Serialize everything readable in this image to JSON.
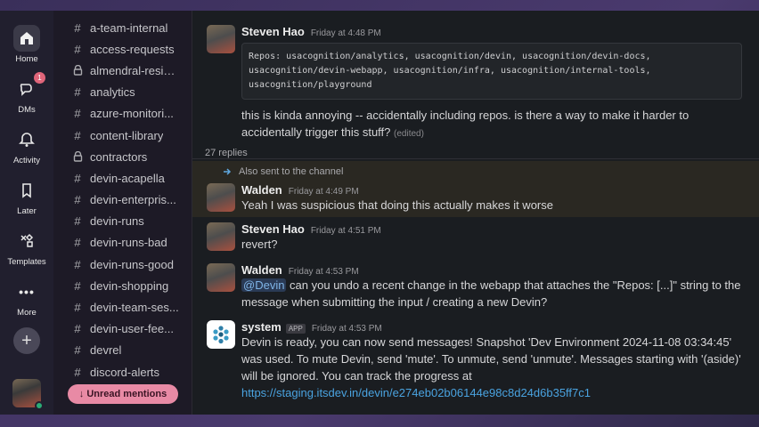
{
  "rail": {
    "items": [
      {
        "label": "Home"
      },
      {
        "label": "DMs",
        "badge": "1"
      },
      {
        "label": "Activity"
      },
      {
        "label": "Later"
      },
      {
        "label": "Templates"
      },
      {
        "label": "More"
      }
    ]
  },
  "channels": {
    "items": [
      {
        "name": "a-team-internal",
        "icon": "hash"
      },
      {
        "name": "access-requests",
        "icon": "hash"
      },
      {
        "name": "almendral-resid...",
        "icon": "lock"
      },
      {
        "name": "analytics",
        "icon": "hash"
      },
      {
        "name": "azure-monitori...",
        "icon": "hash"
      },
      {
        "name": "content-library",
        "icon": "hash"
      },
      {
        "name": "contractors",
        "icon": "lock"
      },
      {
        "name": "devin-acapella",
        "icon": "hash"
      },
      {
        "name": "devin-enterpris...",
        "icon": "hash"
      },
      {
        "name": "devin-runs",
        "icon": "hash"
      },
      {
        "name": "devin-runs-bad",
        "icon": "hash"
      },
      {
        "name": "devin-runs-good",
        "icon": "hash"
      },
      {
        "name": "devin-shopping",
        "icon": "hash"
      },
      {
        "name": "devin-team-ses...",
        "icon": "hash"
      },
      {
        "name": "devin-user-fee...",
        "icon": "hash"
      },
      {
        "name": "devrel",
        "icon": "hash"
      },
      {
        "name": "discord-alerts",
        "icon": "hash"
      }
    ],
    "unread_label": "↓ Unread mentions"
  },
  "thread": {
    "root": {
      "author": "Steven Hao",
      "time": "Friday at 4:48 PM",
      "code_lines": [
        "Repos: usacognition/analytics, usacognition/devin, usacognition/devin-docs,",
        "usacognition/devin-webapp, usacognition/infra, usacognition/internal-tools,",
        "usacognition/playground"
      ],
      "text_line1": "this is kinda annoying -- accidentally including repos. is there a way to make it harder to",
      "text_line2": "accidentally trigger this stuff?",
      "edited": "(edited)"
    },
    "replies_count": "27 replies",
    "also_sent": "Also sent to the channel",
    "replies": [
      {
        "author": "Walden",
        "time": "Friday at 4:49 PM",
        "text": "Yeah I was suspicious that doing this actually makes it worse"
      },
      {
        "author": "Steven Hao",
        "time": "Friday at 4:51 PM",
        "text": "revert?"
      },
      {
        "author": "Walden",
        "time": "Friday at 4:53 PM",
        "mention": "@Devin",
        "text_line1": " can you undo a recent change in the webapp that attaches the \"Repos: [...]\" string to the",
        "text_line2": "message when submitting the input / creating a new Devin?"
      },
      {
        "author": "system",
        "app_tag": "APP",
        "time": "Friday at 4:53 PM",
        "lines": [
          "Devin is ready, you can now send messages! Snapshot 'Dev Environment 2024-11-08 03:34:45'",
          "was used. To mute Devin, send 'mute'. To unmute, send 'unmute'. Messages starting with '(aside)'",
          "will be ignored. You can track the progress at"
        ],
        "link": "https://staging.itsdev.in/devin/e274eb02b06144e98c8d24d6b35ff7c1"
      }
    ]
  },
  "colors": {
    "rail_bg": "#211f2e",
    "channels_bg": "#1d1a26",
    "main_bg": "#1a1d21",
    "accent_pink": "#e88aa5",
    "link": "#4aa3e0",
    "highlight": "#2a2822"
  }
}
